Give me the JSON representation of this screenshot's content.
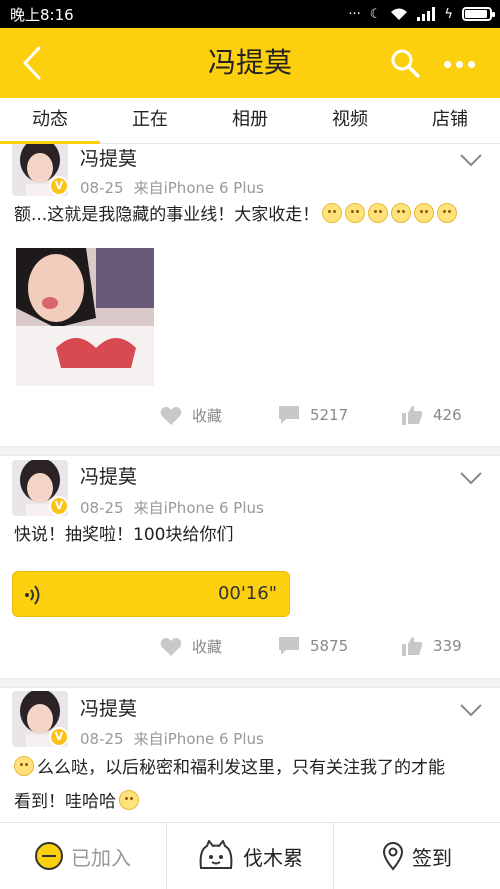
{
  "status_bar": {
    "time": "晚上8:16"
  },
  "header": {
    "title": "冯提莫"
  },
  "tabs": [
    {
      "label": "动态",
      "active": true
    },
    {
      "label": "正在",
      "active": false
    },
    {
      "label": "相册",
      "active": false
    },
    {
      "label": "视频",
      "active": false
    },
    {
      "label": "店铺",
      "active": false
    }
  ],
  "posts": [
    {
      "author": "冯提莫",
      "date": "08-25",
      "source": "来自iPhone 6 Plus",
      "text": "额...这就是我隐藏的事业线！大家收走！",
      "trailing_emoji_count": 6,
      "actions": {
        "favorite_label": "收藏",
        "comments": "5217",
        "likes": "426"
      }
    },
    {
      "author": "冯提莫",
      "date": "08-25",
      "source": "来自iPhone 6 Plus",
      "text": "快说！抽奖啦！100块给你们",
      "voice_duration": "00'16\"",
      "actions": {
        "favorite_label": "收藏",
        "comments": "5875",
        "likes": "339"
      }
    },
    {
      "author": "冯提莫",
      "date": "08-25",
      "source": "来自iPhone 6 Plus",
      "text_line1": "么么哒，以后秘密和福利发这里，只有关注我了的才能",
      "text_line2": "看到！哇哈哈"
    }
  ],
  "bottom_bar": {
    "joined_label": "已加入",
    "group_label": "伐木累",
    "checkin_label": "签到"
  },
  "colors": {
    "brand_yellow": "#FDD00F"
  }
}
